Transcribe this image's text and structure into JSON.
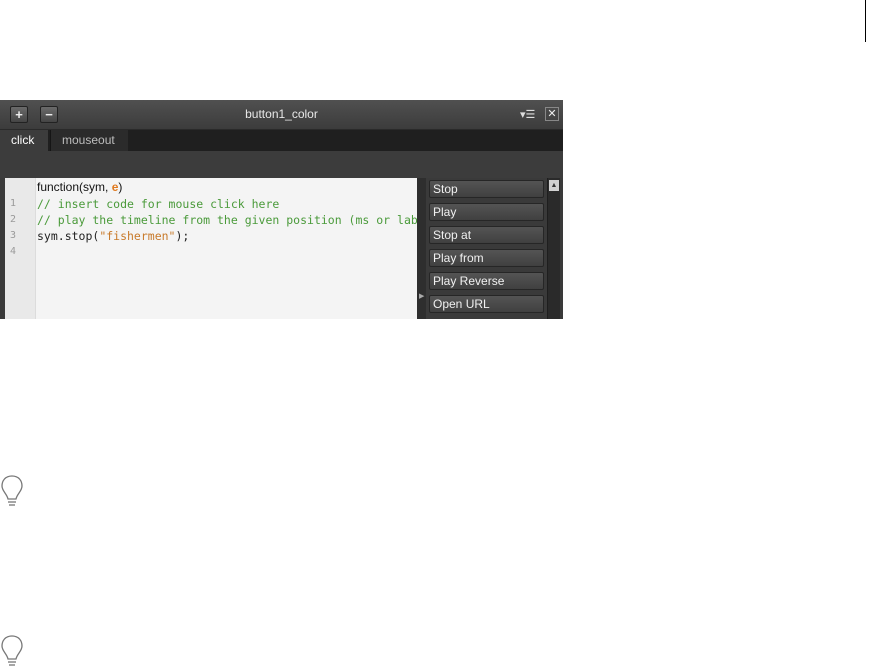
{
  "panel": {
    "title": "button1_color",
    "add_button": "+",
    "remove_button": "−",
    "menu_icon": "panel-menu-icon",
    "close_label": "✕"
  },
  "tabs": [
    {
      "label": "click",
      "active": true
    },
    {
      "label": "mouseout",
      "active": false
    }
  ],
  "editor": {
    "function_signature": "function(sym, ",
    "param": "e",
    "close_paren": ")",
    "lines": [
      {
        "num": "1",
        "text": "// insert code for mouse click here"
      },
      {
        "num": "2",
        "text": "// play the timeline from the given position (ms or label"
      },
      {
        "num": "3",
        "prefix": "sym.stop(",
        "string": "\"fishermen\"",
        "suffix": ");"
      },
      {
        "num": "4",
        "text": ""
      }
    ]
  },
  "actions": [
    "Stop",
    "Play",
    "Stop at",
    "Play from",
    "Play Reverse",
    "Open URL"
  ],
  "colors": {
    "panel_bg": "#3a3a3a",
    "comment": "#4a9a3a",
    "string": "#c87a2a",
    "param": "#e07a1f"
  },
  "icons": [
    "lightbulb-tip-icon",
    "lightbulb-tip-icon"
  ]
}
